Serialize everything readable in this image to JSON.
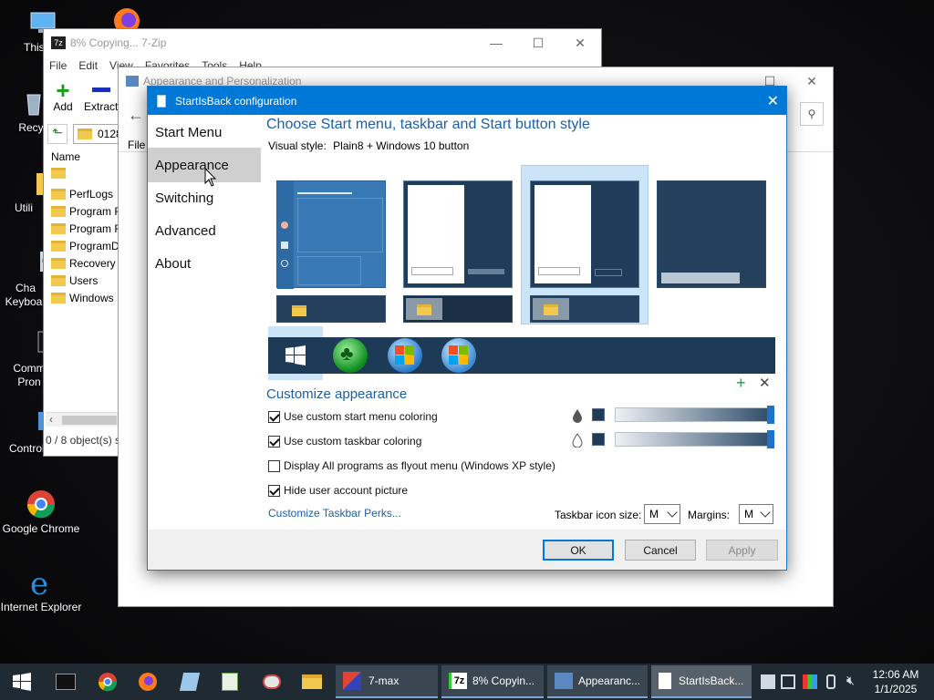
{
  "desktop": {
    "icons": [
      {
        "label": "This"
      },
      {
        "label": "Recyc"
      },
      {
        "label": "Utili"
      },
      {
        "label": "Cha Keyboar"
      },
      {
        "label": "Comm Pron"
      },
      {
        "label": "Control"
      },
      {
        "label": "Google Chrome"
      },
      {
        "label": "Internet Explorer"
      }
    ]
  },
  "zip_window": {
    "title": "8% Copying... 7-Zip",
    "menu": [
      "File",
      "Edit",
      "View",
      "Favorites",
      "Tools",
      "Help"
    ],
    "toolbar": {
      "add": "Add",
      "extract": "Extract"
    },
    "path": "0128",
    "column_name": "Name",
    "files": [
      "PerfLogs",
      "Program Fi",
      "Program Fi",
      "ProgramDa",
      "Recovery",
      "Users",
      "Windows"
    ],
    "status": "0 / 8 object(s) s"
  },
  "appearance_window": {
    "title": "Appearance and Personalization",
    "menu_file": "File"
  },
  "dialog": {
    "title": "StartIsBack configuration",
    "sidebar": [
      "Start Menu",
      "Appearance",
      "Switching",
      "Advanced",
      "About"
    ],
    "heading": "Choose Start menu, taskbar and Start button style",
    "visual_style_label": "Visual style:",
    "visual_style_value": "Plain8 + Windows 10 button",
    "customize_heading": "Customize appearance",
    "options": [
      {
        "label": "Use custom start menu coloring",
        "checked": true
      },
      {
        "label": "Use custom taskbar coloring",
        "checked": true
      },
      {
        "label": "Display All programs as flyout menu (Windows XP style)",
        "checked": false
      },
      {
        "label": "Hide user account picture",
        "checked": true
      }
    ],
    "perks_link": "Customize Taskbar Perks...",
    "icon_size_label": "Taskbar icon size:",
    "icon_size_value": "M",
    "margins_label": "Margins:",
    "margins_value": "M",
    "ok": "OK",
    "cancel": "Cancel",
    "apply": "Apply",
    "accent_color": "#0078d7",
    "swatch_color": "#1f3b57"
  },
  "taskbar": {
    "tasks": [
      {
        "label": "7-max"
      },
      {
        "label": "8% Copyin..."
      },
      {
        "label": "Appearanc..."
      },
      {
        "label": "StartIsBack..."
      }
    ],
    "time": "12:06 AM",
    "date": "1/1/2025"
  }
}
